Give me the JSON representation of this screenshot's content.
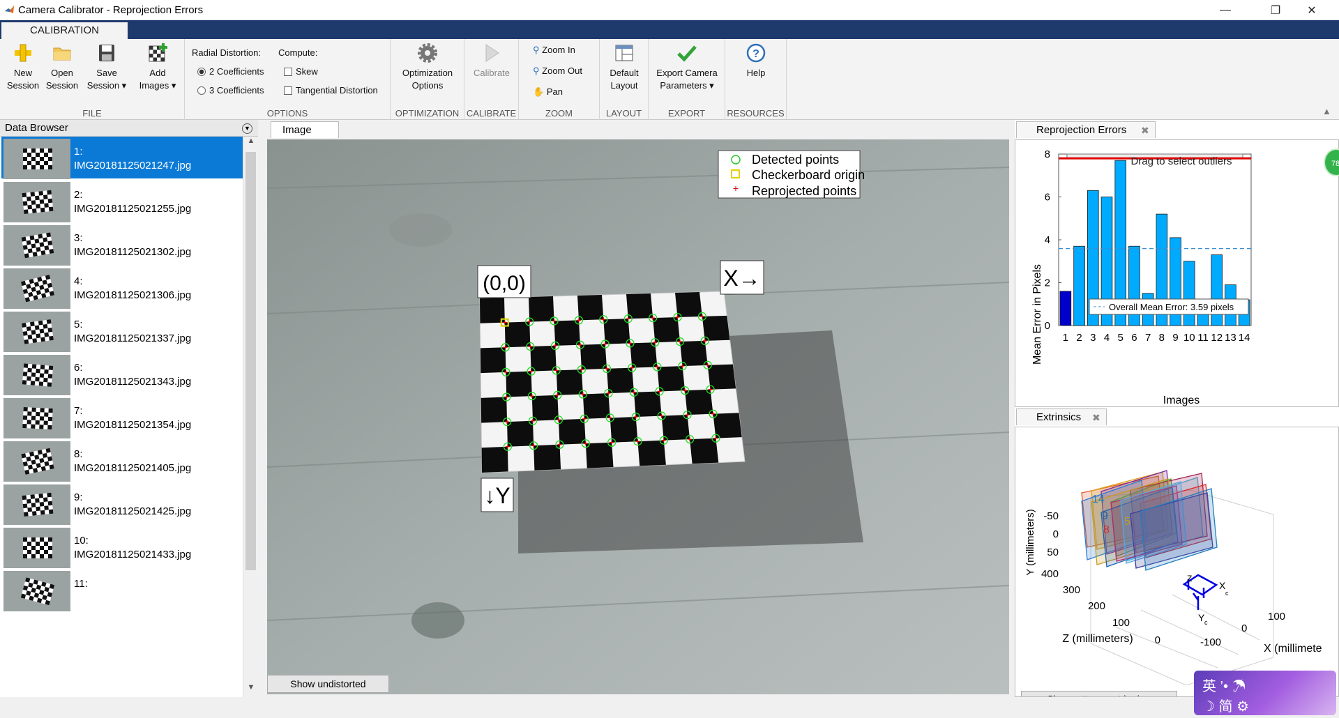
{
  "window": {
    "title": "Camera Calibrator - Reprojection Errors",
    "minimize": "—",
    "maximize": "❐",
    "close": "✕"
  },
  "ribbon": {
    "tab": "CALIBRATION",
    "groups": {
      "file": "FILE",
      "options": "OPTIONS",
      "optimization": "OPTIMIZATION",
      "calibrate": "CALIBRATE",
      "zoom": "ZOOM",
      "layout": "LAYOUT",
      "export": "EXPORT",
      "resources": "RESOURCES"
    },
    "new_session": [
      "New",
      "Session"
    ],
    "open_session": [
      "Open",
      "Session"
    ],
    "save_session": [
      "Save",
      "Session ▾"
    ],
    "add_images": [
      "Add",
      "Images ▾"
    ],
    "radial_distortion_label": "Radial Distortion:",
    "radial_options": [
      "2 Coefficients",
      "3 Coefficients"
    ],
    "compute_label": "Compute:",
    "compute_options": [
      "Skew",
      "Tangential Distortion"
    ],
    "optimization_options": [
      "Optimization",
      "Options"
    ],
    "calibrate": "Calibrate",
    "zoom_in": "Zoom In",
    "zoom_out": "Zoom Out",
    "pan": "Pan",
    "default_layout": [
      "Default",
      "Layout"
    ],
    "export_camera": [
      "Export Camera",
      "Parameters ▾"
    ],
    "help": "Help"
  },
  "data_browser": {
    "title": "Data Browser",
    "items": [
      {
        "index": "1:",
        "file": "IMG20181125021247.jpg",
        "selected": true
      },
      {
        "index": "2:",
        "file": "IMG20181125021255.jpg",
        "selected": false
      },
      {
        "index": "3:",
        "file": "IMG20181125021302.jpg",
        "selected": false
      },
      {
        "index": "4:",
        "file": "IMG20181125021306.jpg",
        "selected": false
      },
      {
        "index": "5:",
        "file": "IMG20181125021337.jpg",
        "selected": false
      },
      {
        "index": "6:",
        "file": "IMG20181125021343.jpg",
        "selected": false
      },
      {
        "index": "7:",
        "file": "IMG20181125021354.jpg",
        "selected": false
      },
      {
        "index": "8:",
        "file": "IMG20181125021405.jpg",
        "selected": false
      },
      {
        "index": "9:",
        "file": "IMG20181125021425.jpg",
        "selected": false
      },
      {
        "index": "10:",
        "file": "IMG20181125021433.jpg",
        "selected": false
      },
      {
        "index": "11:",
        "file": "",
        "selected": false
      }
    ]
  },
  "image_panel": {
    "tab": "Image",
    "legend": [
      "Detected points",
      "Checkerboard origin",
      "Reprojected points"
    ],
    "origin_label": "(0,0)",
    "x_label": "X→",
    "y_label": "↓Y",
    "show_undistorted": "Show undistorted"
  },
  "reprojection": {
    "tab": "Reprojection Errors",
    "close": "✖",
    "drag_hint": "Drag to select outliers",
    "badge": "78",
    "chart_data": {
      "type": "bar",
      "title": "",
      "xlabel": "Images",
      "ylabel": "Mean Error in Pixels",
      "categories": [
        "1",
        "2",
        "3",
        "4",
        "5",
        "6",
        "7",
        "8",
        "9",
        "10",
        "11",
        "12",
        "13",
        "14"
      ],
      "values": [
        1.6,
        3.7,
        6.3,
        6.0,
        7.7,
        3.7,
        1.5,
        5.2,
        4.1,
        3.0,
        1.2,
        3.3,
        1.9,
        1.2
      ],
      "ylim": [
        0,
        8
      ],
      "yticks": [
        "0",
        "2",
        "4",
        "6",
        "8"
      ],
      "mean_error": 3.59,
      "mean_label": "Overall Mean Error: 3.59 pixels",
      "threshold": 7.8,
      "colors": {
        "bar": "#00aaff",
        "selected": "#0000cc",
        "threshold": "#e00000",
        "mean": "#3a8fd0"
      }
    }
  },
  "extrinsics": {
    "tab": "Extrinsics",
    "close": "✖",
    "y_axis_label": "Y (millimeters)",
    "z_axis_label": "Z (millimeters)",
    "x_axis_label": "X (millimete",
    "y_ticks": [
      "-50",
      "0",
      "50"
    ],
    "z_ticks": [
      "400",
      "300",
      "200",
      "100",
      "0"
    ],
    "x_ticks": [
      "100",
      "0",
      "-100"
    ],
    "plane_numbers": [
      "14",
      "9",
      "8",
      "5"
    ],
    "camera_axes": [
      "Z",
      "X",
      "Y"
    ],
    "camera_sub": "c",
    "pattern_btn": "Show pattern-centric view"
  },
  "ime": {
    "line1": "英 ’• ☂",
    "line2": "☽ 简 ⚙"
  }
}
